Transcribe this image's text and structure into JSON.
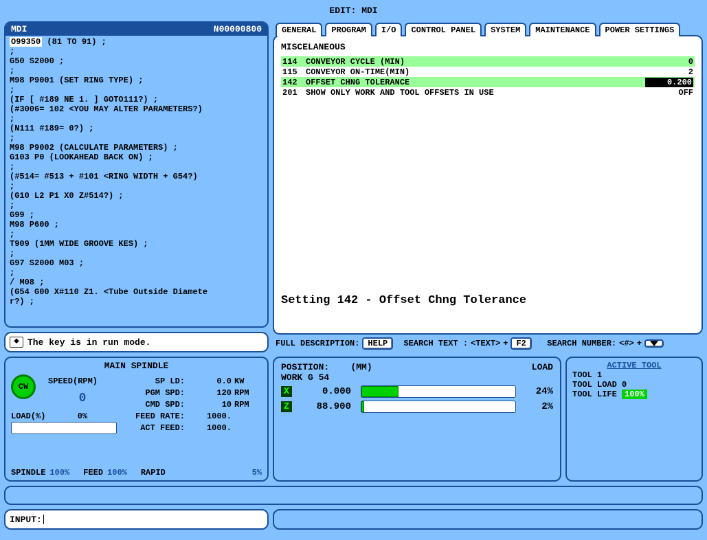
{
  "title": "EDIT: MDI",
  "code": {
    "header_left": "MDI",
    "header_right": "N00000800",
    "highlight": "O99350",
    "line1_rest": " (81 TO 91) ;",
    "lines": [
      ";",
      "G50 S2000 ;",
      ";",
      "M98 P9001 (SET RING TYPE) ;",
      ";",
      "(IF [ #189 NE 1. ] GOTO111?) ;",
      "(#3006= 102 <YOU MAY ALTER PARAMETERS?)",
      ";",
      "(N111 #189= 0?) ;",
      ";",
      "M98 P9002 (CALCULATE PARAMETERS) ;",
      "G103 P0 (LOOKAHEAD BACK ON) ;",
      ";",
      "(#514= #513 + #101 <RING WIDTH + G54?)",
      ";",
      "(G10 L2 P1 X0 Z#514?) ;",
      ";",
      "G99 ;",
      "M98 P600 ;",
      ";",
      "T909 (1MM WIDE GROOVE KES) ;",
      ";",
      "G97 S2000 M03 ;",
      ";",
      "/ M08 ;",
      "(G54 G00 X#110 Z1. <Tube Outside Diamete",
      "r?) ;"
    ]
  },
  "key_mode": "The key is in run mode.",
  "tabs": [
    "GENERAL",
    "PROGRAM",
    "I/O",
    "CONTROL PANEL",
    "SYSTEM",
    "MAINTENANCE",
    "POWER SETTINGS"
  ],
  "settings": {
    "title": "MISCELANEOUS",
    "rows": [
      {
        "id": "114",
        "name": "CONVEYOR CYCLE (MIN)",
        "val": "0",
        "green": true,
        "sel": false
      },
      {
        "id": "115",
        "name": "CONVEYOR ON-TIME(MIN)",
        "val": "2",
        "green": false,
        "sel": false
      },
      {
        "id": "142",
        "name": "OFFSET CHNG TOLERANCE",
        "val": "0.200",
        "green": true,
        "sel": true
      },
      {
        "id": "201",
        "name": "SHOW ONLY WORK AND TOOL OFFSETS IN USE",
        "val": "OFF",
        "green": false,
        "sel": false
      }
    ],
    "desc": "Setting 142 - Offset Chng Tolerance"
  },
  "search": {
    "full_desc": "FULL DESCRIPTION:",
    "help": "HELP",
    "text_label": "SEARCH TEXT :",
    "text_ph": "<TEXT>",
    "plus": "+",
    "f2": "F2",
    "num_label": "SEARCH NUMBER:",
    "num_ph": "<#>"
  },
  "spindle": {
    "title": "MAIN SPINDLE",
    "dir": "CW",
    "speed_label": "SPEED(RPM)",
    "rpm": "0",
    "spld": {
      "label": "SP LD:",
      "val": "0.0",
      "unit": "KW"
    },
    "pgm": {
      "label": "PGM SPD:",
      "val": "120",
      "unit": "RPM"
    },
    "cmd": {
      "label": "CMD SPD:",
      "val": "10",
      "unit": "RPM"
    },
    "feed": {
      "label": "FEED RATE:",
      "val": "1000."
    },
    "act": {
      "label": "ACT FEED:",
      "val": "1000."
    },
    "load_label": "LOAD(%)",
    "load_val": "0%",
    "override": {
      "spindle_l": "SPINDLE",
      "spindle_v": "100%",
      "feed_l": "FEED",
      "feed_v": "100%",
      "rapid_l": "RAPID",
      "rapid_v": "5%"
    }
  },
  "position": {
    "title": "POSITION:",
    "units": "(MM)",
    "load": "LOAD",
    "work": "WORK G 54",
    "axes": [
      {
        "axis": "X",
        "pos": "0.000",
        "pct": "24%",
        "fill": 24
      },
      {
        "axis": "Z",
        "pos": "88.900",
        "pct": "2%",
        "fill": 2
      }
    ]
  },
  "tool": {
    "title": "ACTIVE TOOL",
    "line1": "TOOL 1",
    "line2": "TOOL LOAD 0",
    "line3_l": "TOOL LIFE ",
    "line3_v": "100%"
  },
  "input": {
    "label": "INPUT: "
  }
}
